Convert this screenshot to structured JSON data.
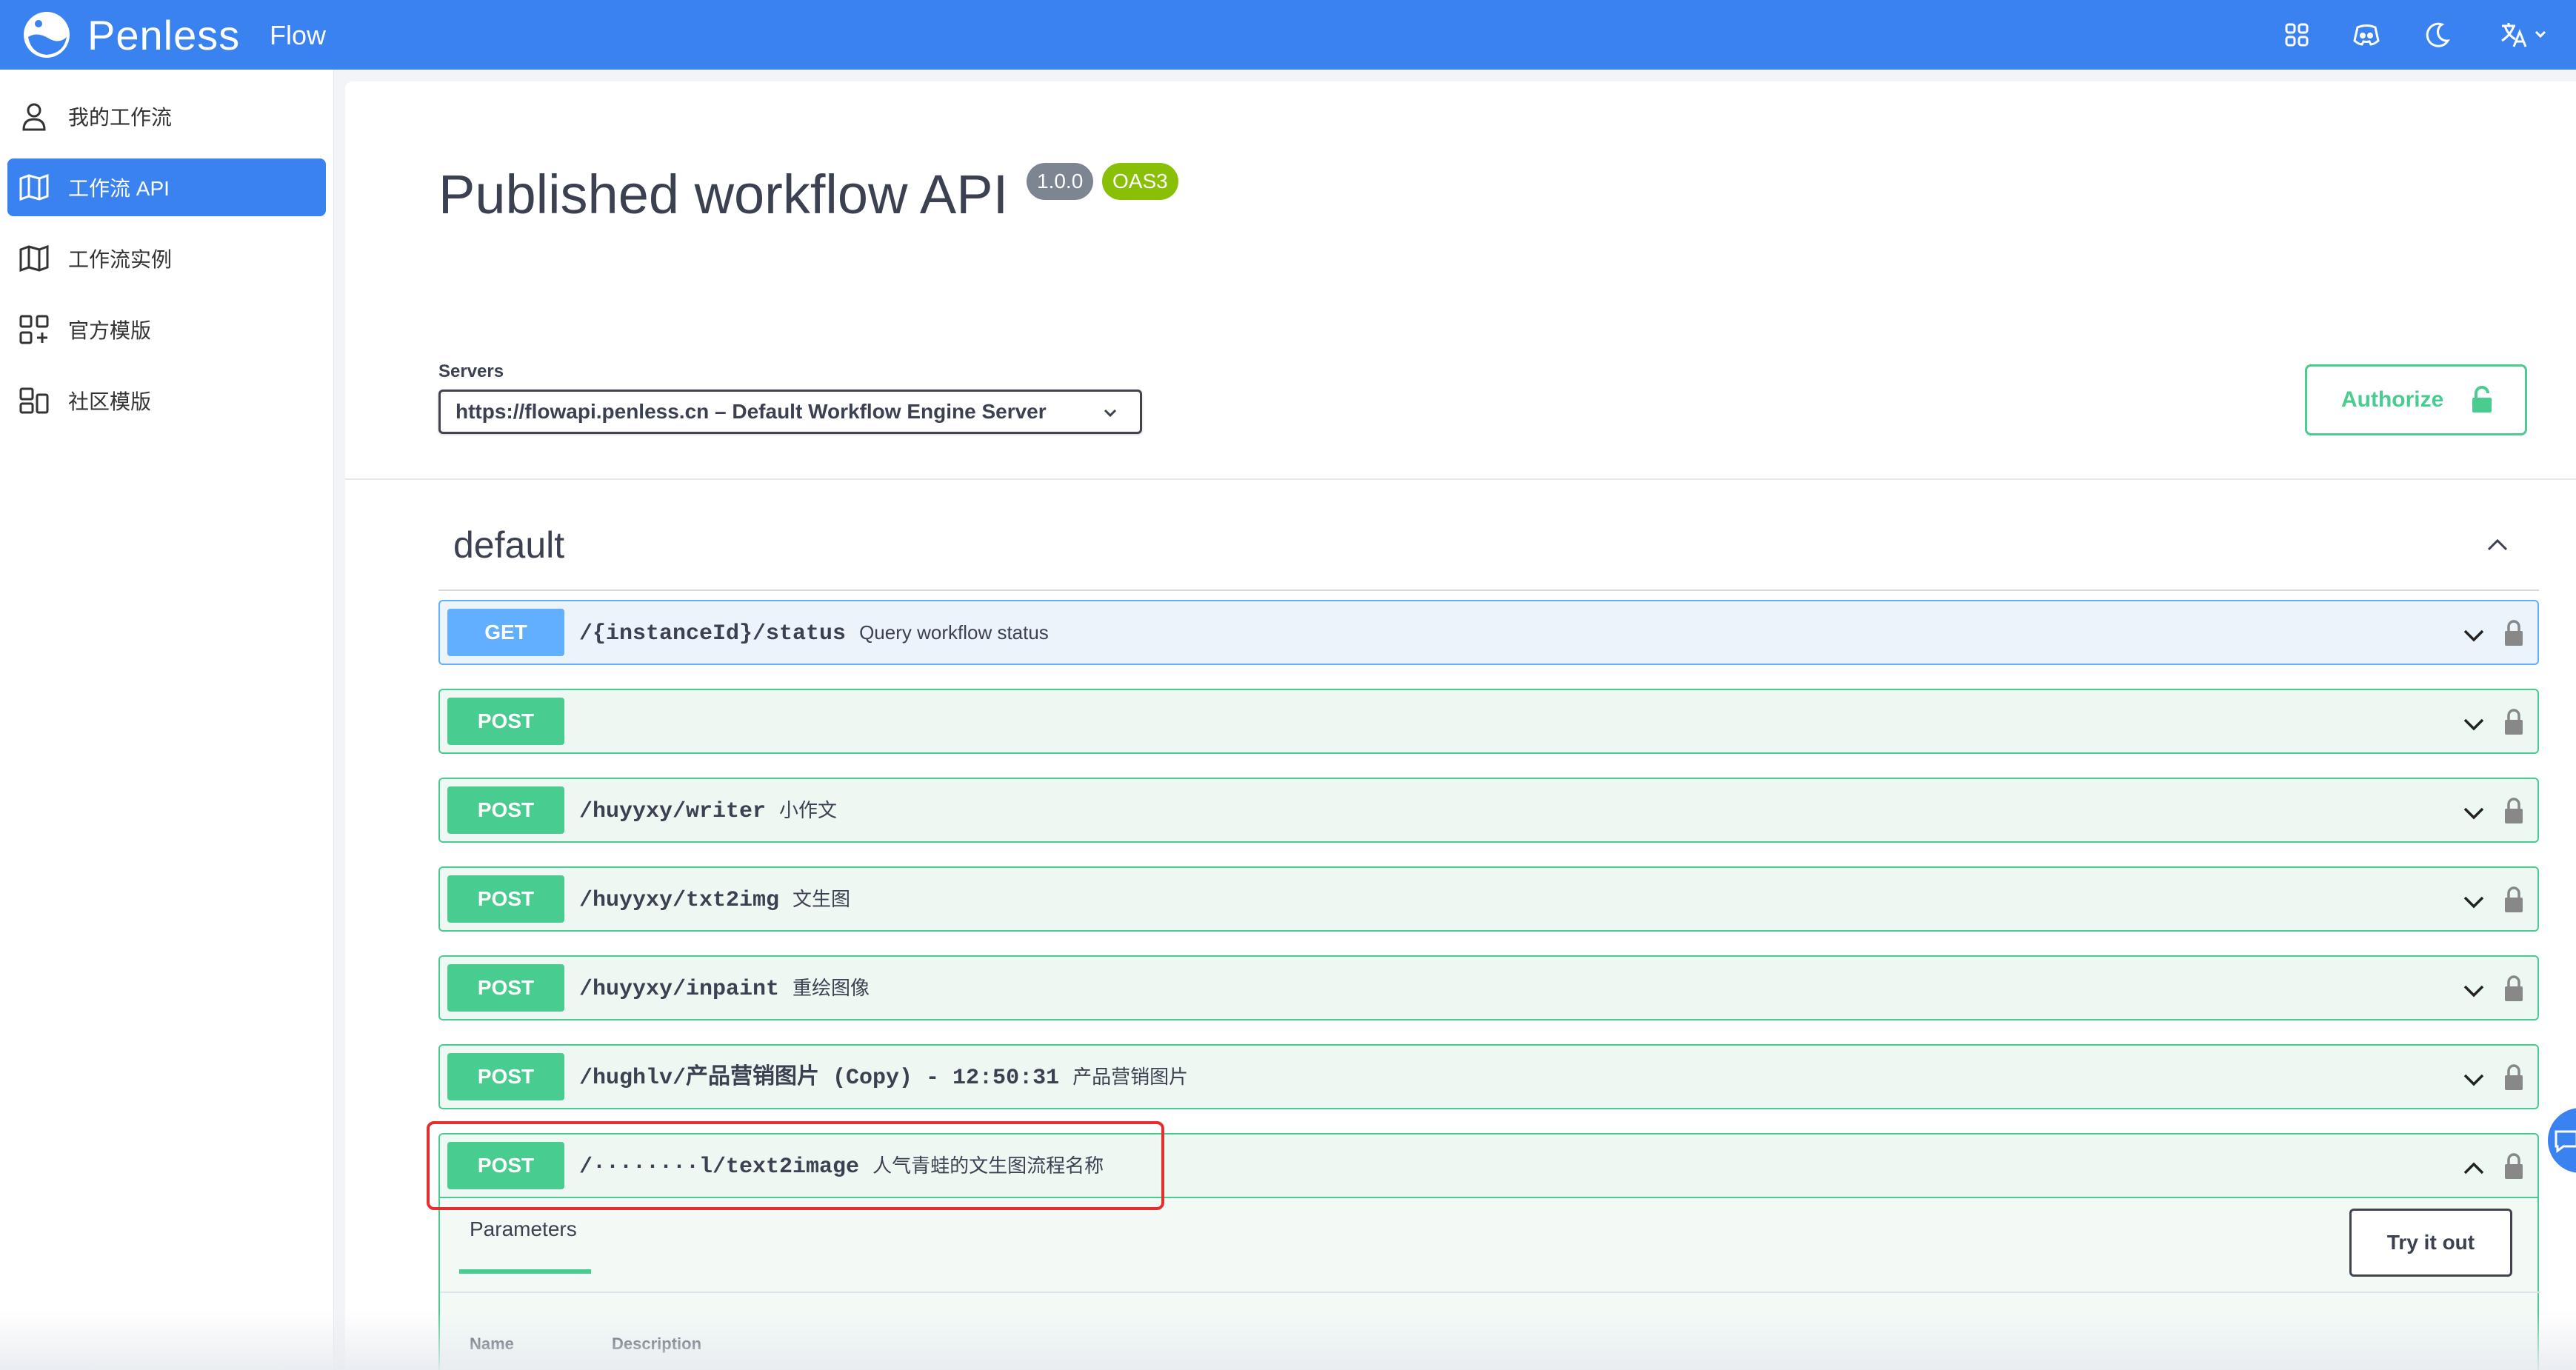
{
  "topbar": {
    "brand": "Penless",
    "subtitle": "Flow",
    "icons": [
      "apps-grid-icon",
      "discord-icon",
      "moon-icon",
      "translate-icon"
    ]
  },
  "sidebar": {
    "items": [
      {
        "label": "我的工作流",
        "icon": "user-icon",
        "active": false
      },
      {
        "label": "工作流 API",
        "icon": "map-icon",
        "active": true
      },
      {
        "label": "工作流实例",
        "icon": "map-icon",
        "active": false
      },
      {
        "label": "官方模版",
        "icon": "grid-plus-icon",
        "active": false
      },
      {
        "label": "社区模版",
        "icon": "layout-icon",
        "active": false
      }
    ]
  },
  "api": {
    "title": "Published workflow API",
    "version": "1.0.0",
    "spec": "OAS3",
    "servers_label": "Servers",
    "server_selected": "https://flowapi.penless.cn – Default Workflow Engine Server",
    "authorize_label": "Authorize",
    "tag": "default"
  },
  "operations": [
    {
      "method": "GET",
      "path": "/{instanceId}/status",
      "summary": "Query workflow status"
    },
    {
      "method": "POST",
      "path": "",
      "summary": ""
    },
    {
      "method": "POST",
      "path": "/huyyxy/writer",
      "summary": "小作文"
    },
    {
      "method": "POST",
      "path": "/huyyxy/txt2img",
      "summary": "文生图"
    },
    {
      "method": "POST",
      "path": "/huyyxy/inpaint",
      "summary": "重绘图像"
    },
    {
      "method": "POST",
      "path": "/hughlv/产品营销图片 (Copy) - 12:50:31",
      "summary": "产品营销图片"
    },
    {
      "method": "POST",
      "path": "/········l/text2image",
      "summary": "人气青蛙的文生图流程名称"
    }
  ],
  "expanded": {
    "tab_label": "Parameters",
    "try_label": "Try it out",
    "col_name": "Name",
    "col_desc": "Description"
  },
  "colors": {
    "topbar": "#3a82f0",
    "post": "#49cc90",
    "get": "#61affe",
    "highlight": "#e3302f"
  }
}
